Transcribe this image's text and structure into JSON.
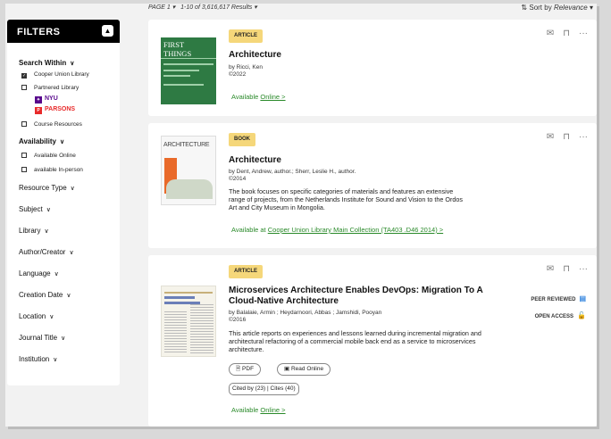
{
  "topbar": {
    "page_label": "PAGE 1",
    "results_text": "1-10 of 3,616,617 Results",
    "sort_prefix": "Sort by",
    "sort_value": "Relevance"
  },
  "sidebar": {
    "title": "FILTERS",
    "search_within": {
      "title": "Search Within",
      "options": [
        {
          "label": "Cooper Union Library",
          "checked": true
        },
        {
          "label": "Partnered Library",
          "checked": false
        },
        {
          "label": "Course Resources",
          "checked": false
        }
      ],
      "partners": [
        "NYU",
        "PARSONS"
      ]
    },
    "availability": {
      "title": "Availability",
      "options": [
        {
          "label": "Available Online",
          "checked": false
        },
        {
          "label": "available In-person",
          "checked": false
        }
      ]
    },
    "facets": [
      "Resource Type",
      "Subject",
      "Library",
      "Author/Creator",
      "Language",
      "Creation Date",
      "Location",
      "Journal Title",
      "Institution"
    ]
  },
  "results": [
    {
      "type": "ARTICLE",
      "title": "Architecture",
      "byline": "by Ricci, Ken",
      "year": "©2022",
      "avail_prefix": "Available",
      "avail_link": "Online >",
      "thumb_title": "FIRST THINGS"
    },
    {
      "type": "BOOK",
      "title": "Architecture",
      "byline": "by Dent, Andrew, author.; Sherr, Leslie H., author.",
      "year": "©2014",
      "abstract": "The book focuses on specific categories of materials and features an extensive range of projects, from the Netherlands Institute for Sound and Vision to the Ordos Art and City Museum in Mongolia.",
      "avail_prefix": "Available at",
      "avail_link": "Cooper Union Library Main Collection (TA403 .D46 2014) >",
      "thumb_title": "ARCHITECTURE"
    },
    {
      "type": "ARTICLE",
      "title": "Microservices Architecture Enables DevOps: Migration To A Cloud-Native Architecture",
      "byline": "by Balalaie, Armin ; Heydarnoori, Abbas ; Jamshidi, Pooyan",
      "year": "©2016",
      "abstract": "This article reports on experiences and lessons learned during incremental migration and architectural refactoring of a commercial mobile back end as a service to microservices architecture.",
      "pdf_label": "PDF",
      "read_label": "Read Online",
      "cited_by": "Cited by (23)",
      "cites": "Cites (40)",
      "avail_prefix": "Available",
      "avail_link": "Online >",
      "peer_reviewed": "PEER REVIEWED",
      "open_access": "OPEN ACCESS"
    }
  ],
  "colors": {
    "badge": "#f5d77a",
    "link_green": "#2a8a2a",
    "nyu_purple": "#57068c",
    "parsons_red": "#e82b2b"
  }
}
